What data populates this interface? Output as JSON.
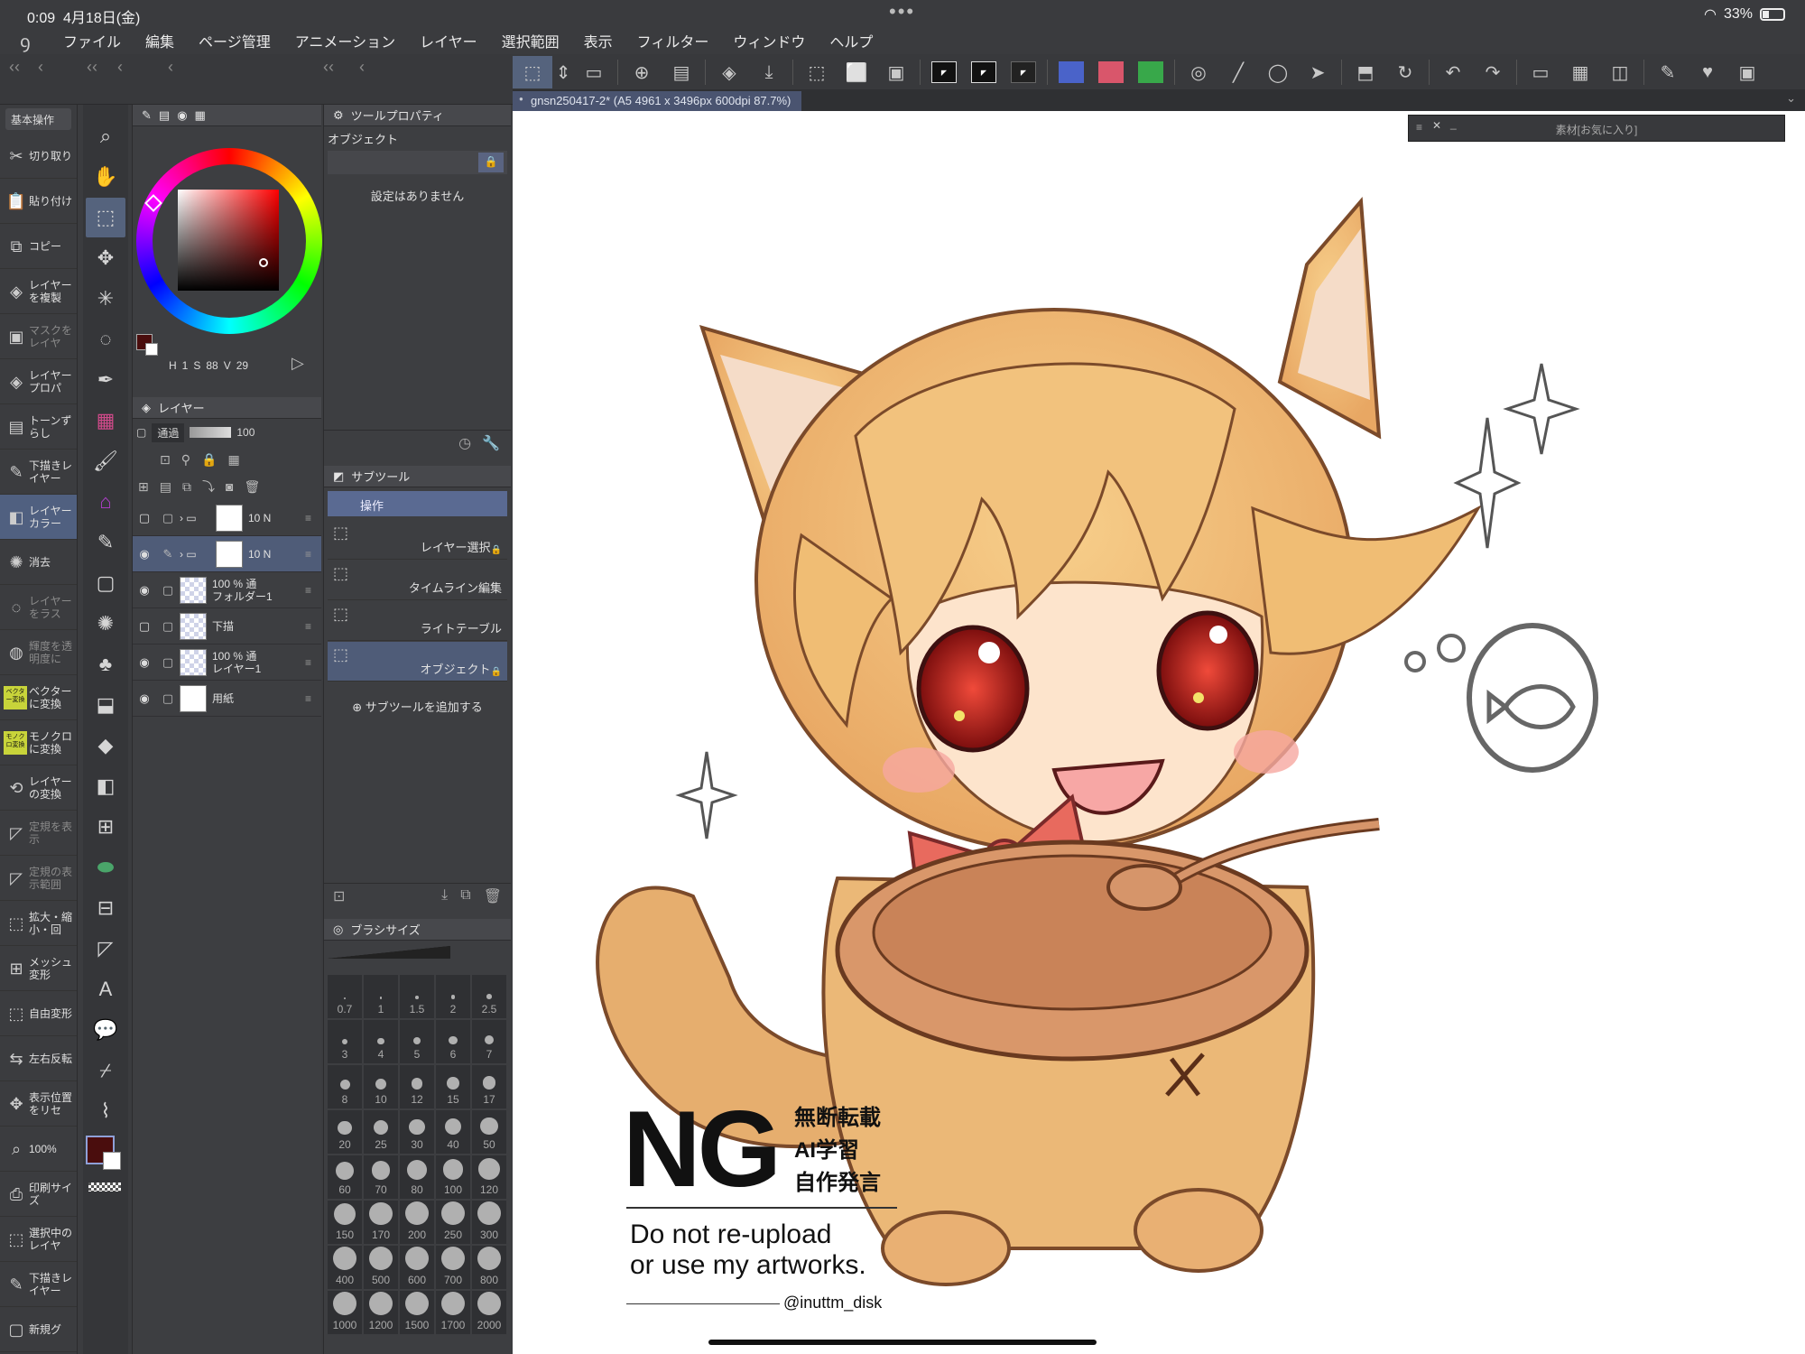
{
  "status": {
    "time": "0:09",
    "date": "4月18日(金)",
    "dots": "•••",
    "battery": "33%"
  },
  "menu": [
    "ファイル",
    "編集",
    "ページ管理",
    "アニメーション",
    "レイヤー",
    "選択範囲",
    "表示",
    "フィルター",
    "ウィンドウ",
    "ヘルプ"
  ],
  "document_tab": "gnsn250417-2* (A5 4961 x 3496px 600dpi 87.7%)",
  "favorites_title": "素材[お気に入り]",
  "command_bar": {
    "header": "基本操作",
    "items": [
      {
        "label": "切り取り",
        "icon": "scissors-icon",
        "state": "normal"
      },
      {
        "label": "貼り付け",
        "icon": "paste-icon",
        "state": "normal"
      },
      {
        "label": "コピー",
        "icon": "copy-icon",
        "state": "normal"
      },
      {
        "label": "レイヤーを複製",
        "icon": "duplicate-layer-icon",
        "state": "normal"
      },
      {
        "label": "マスクをレイヤ",
        "icon": "mask-icon",
        "state": "dim"
      },
      {
        "label": "レイヤープロパ",
        "icon": "layer-property-icon",
        "state": "normal"
      },
      {
        "label": "トーンずらし",
        "icon": "tone-icon",
        "state": "normal"
      },
      {
        "label": "下描きレイヤー",
        "icon": "draft-icon",
        "state": "normal"
      },
      {
        "label": "レイヤーカラー",
        "icon": "layer-color-icon",
        "state": "active"
      },
      {
        "label": "消去",
        "icon": "clear-icon",
        "state": "normal"
      },
      {
        "label": "レイヤーをラス",
        "icon": "rasterize-icon",
        "state": "dim"
      },
      {
        "label": "輝度を透明度に",
        "icon": "luminance-icon",
        "state": "dim"
      },
      {
        "label": "ベクターに変換",
        "icon": "vector-icon",
        "state": "badge",
        "badge": "ベクター変換"
      },
      {
        "label": "モノクロに変換",
        "icon": "mono-icon",
        "state": "badge",
        "badge": "モノクロ変換"
      },
      {
        "label": "レイヤーの変換",
        "icon": "convert-icon",
        "state": "normal"
      },
      {
        "label": "定規を表示",
        "icon": "ruler-icon",
        "state": "dim"
      },
      {
        "label": "定規の表示範囲",
        "icon": "ruler-range-icon",
        "state": "dim"
      },
      {
        "label": "拡大・縮小・回",
        "icon": "scale-icon",
        "state": "normal"
      },
      {
        "label": "メッシュ変形",
        "icon": "mesh-icon",
        "state": "normal"
      },
      {
        "label": "自由変形",
        "icon": "free-transform-icon",
        "state": "normal"
      },
      {
        "label": "左右反転",
        "icon": "flip-icon",
        "state": "normal"
      },
      {
        "label": "表示位置をリセ",
        "icon": "reset-view-icon",
        "state": "normal"
      },
      {
        "label": "100%",
        "icon": "zoom-icon",
        "state": "normal"
      },
      {
        "label": "印刷サイズ",
        "icon": "print-size-icon",
        "state": "normal"
      },
      {
        "label": "選択中のレイヤ",
        "icon": "selected-layer-icon",
        "state": "normal"
      },
      {
        "label": "下描きレイヤー",
        "icon": "draft-layer-icon",
        "state": "normal"
      },
      {
        "label": "新規グ",
        "icon": "new-group-icon",
        "state": "normal"
      }
    ]
  },
  "color": {
    "main": "#4a0d0d",
    "sub": "#ffffff",
    "hsv": {
      "h_label": "H",
      "h": "1",
      "s_label": "S",
      "s": "88",
      "v_label": "V",
      "v": "29"
    }
  },
  "layer_panel": {
    "title": "レイヤー",
    "blend": "通過",
    "opacity": "100",
    "layers": [
      {
        "name": "10 N",
        "pct": "",
        "visible": false,
        "type": "folder",
        "selected": false
      },
      {
        "name": "10 N",
        "pct": "",
        "visible": true,
        "type": "folder",
        "selected": true
      },
      {
        "name": "フォルダー1",
        "pct": "100 % 通",
        "visible": true,
        "type": "raster",
        "selected": false
      },
      {
        "name": "下描",
        "pct": "",
        "visible": false,
        "type": "raster",
        "selected": false
      },
      {
        "name": "レイヤー1",
        "pct": "100 % 通",
        "visible": true,
        "type": "raster",
        "selected": false
      },
      {
        "name": "用紙",
        "pct": "",
        "visible": true,
        "type": "paper",
        "selected": false
      }
    ]
  },
  "tool_property": {
    "title": "ツールプロパティ",
    "section": "オブジェクト",
    "empty": "設定はありません"
  },
  "subtool": {
    "title": "サブツール",
    "group": "操作",
    "items": [
      {
        "label": "レイヤー選択",
        "selected": false
      },
      {
        "label": "タイムライン編集",
        "selected": false
      },
      {
        "label": "ライトテーブル",
        "selected": false
      },
      {
        "label": "オブジェクト",
        "selected": true
      }
    ],
    "add": "サブツールを追加する"
  },
  "brush_size": {
    "title": "ブラシサイズ",
    "sizes": [
      "0.7",
      "1",
      "1.5",
      "2",
      "2.5",
      "3",
      "4",
      "5",
      "6",
      "7",
      "8",
      "10",
      "12",
      "15",
      "17",
      "20",
      "25",
      "30",
      "40",
      "50",
      "60",
      "70",
      "80",
      "100",
      "120",
      "150",
      "170",
      "200",
      "250",
      "300",
      "400",
      "500",
      "600",
      "700",
      "800",
      "1000",
      "1200",
      "1500",
      "1700",
      "2000"
    ]
  },
  "artwork": {
    "ng": "NG",
    "ng_lines": [
      "無断転載",
      "AI学習",
      "自作発言"
    ],
    "en_lines": [
      "Do not re-upload",
      "or use my artworks."
    ],
    "handle": "@inuttm_disk"
  }
}
